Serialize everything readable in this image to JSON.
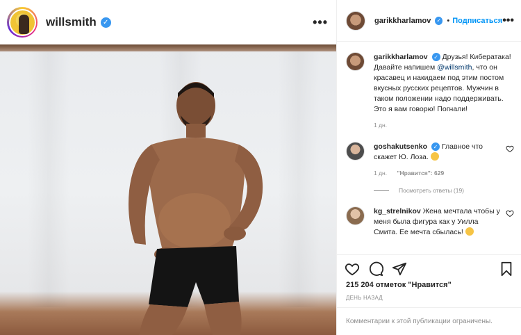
{
  "post_author": {
    "username": "willsmith",
    "verified_icon": "verified-badge-icon",
    "more_icon": "more-options-icon"
  },
  "photo": {
    "description_icon": "post-photo"
  },
  "sidebar_header": {
    "username": "garikkharlamov",
    "separator": "•",
    "follow_label": "Подписаться"
  },
  "comments": [
    {
      "username": "garikkharlamov",
      "text_before": " Друзья! Кибератака! Давайте напишем ",
      "mention": "@willsmith",
      "text_after": ", что он красавец и накидаем под этим постом вкусных русских рецептов. Мужчин в таком положении надо поддерживать. Это я вам говорю! Погнали!",
      "time": "1 дн."
    },
    {
      "username": "goshakutsenko",
      "text": " Главное что скажет Ю. Лоза.",
      "time": "1 дн.",
      "likes": "\"Нравится\": 629",
      "replies": "Посмотреть ответы (19)"
    },
    {
      "username": "kg_strelnikov",
      "text": " Жена мечтала чтобы у меня была фигура как у Уилла Смита. Ее мечта сбылась!"
    }
  ],
  "actions": {
    "like_icon": "heart-icon",
    "comment_icon": "comment-icon",
    "share_icon": "share-icon",
    "save_icon": "bookmark-icon"
  },
  "likes_text": "215 204 отметок \"Нравится\"",
  "timestamp": "День назад",
  "footer_text": "Комментарии к этой публикации ограничены."
}
